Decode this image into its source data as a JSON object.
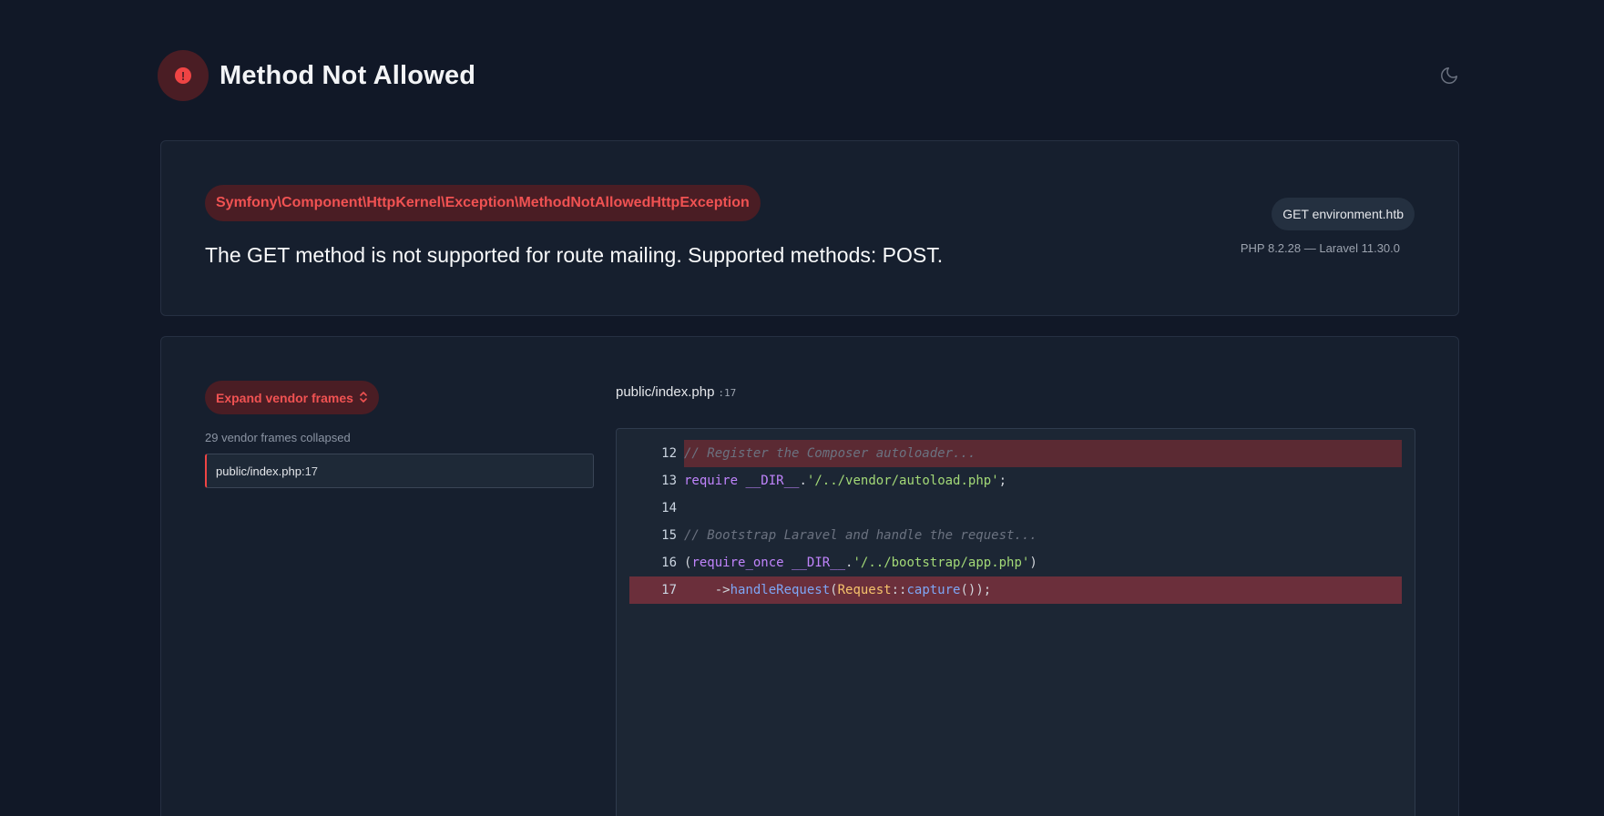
{
  "header": {
    "title": "Method Not Allowed",
    "error_icon": "exclamation-circle-icon",
    "theme_icon": "moon-icon"
  },
  "exception": {
    "class": "Symfony\\Component\\HttpKernel\\Exception\\MethodNotAllowedHttpException",
    "message": "The GET method is not supported for route mailing. Supported methods: POST.",
    "request": "GET environment.htb",
    "versions": "PHP 8.2.28 — Laravel 11.30.0"
  },
  "trace": {
    "expand_label": "Expand vendor frames",
    "expand_icon": "chevron-up-down-icon",
    "vendor_collapsed": "29 vendor frames collapsed",
    "frames": [
      {
        "file": "public/index.php",
        "line": ":17"
      }
    ]
  },
  "code": {
    "file": "public/index.php",
    "line": ":17",
    "lines": [
      {
        "num": "12",
        "tokens": [
          [
            "c-cmt",
            "// Register the Composer autoloader..."
          ]
        ]
      },
      {
        "num": "13",
        "tokens": [
          [
            "c-kw",
            "require"
          ],
          [
            "c-pn",
            " "
          ],
          [
            "c-kw",
            "__DIR__"
          ],
          [
            "c-pn",
            "."
          ],
          [
            "c-str",
            "'/../vendor/autoload.php'"
          ],
          [
            "c-pn",
            ";"
          ]
        ]
      },
      {
        "num": "14",
        "tokens": []
      },
      {
        "num": "15",
        "tokens": [
          [
            "c-cmt",
            "// Bootstrap Laravel and handle the request..."
          ]
        ]
      },
      {
        "num": "16",
        "tokens": [
          [
            "c-pn",
            "("
          ],
          [
            "c-kw",
            "require_once"
          ],
          [
            "c-pn",
            " "
          ],
          [
            "c-kw",
            "__DIR__"
          ],
          [
            "c-pn",
            "."
          ],
          [
            "c-str",
            "'/../bootstrap/app.php'"
          ],
          [
            "c-pn",
            ")"
          ]
        ]
      },
      {
        "num": "17",
        "tokens": [
          [
            "c-pn",
            "    ->"
          ],
          [
            "c-fn",
            "handleRequest"
          ],
          [
            "c-pn",
            "("
          ],
          [
            "c-cls",
            "Request"
          ],
          [
            "c-pn",
            "::"
          ],
          [
            "c-fn",
            "capture"
          ],
          [
            "c-pn",
            "());"
          ]
        ]
      }
    ],
    "highlight_soft": "12",
    "highlight_full": "17"
  },
  "colors": {
    "background": "#111827",
    "card": "#161f2e",
    "accent_red": "#ef4444",
    "badge_bg": "#4a1d24"
  }
}
